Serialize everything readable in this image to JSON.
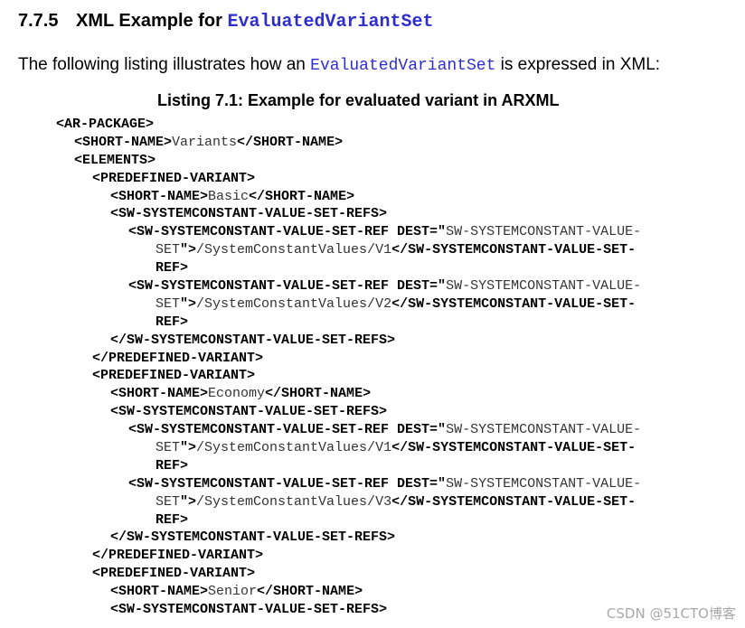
{
  "section": {
    "number": "7.7.5",
    "title_prefix": "XML Example for ",
    "title_code": "EvaluatedVariantSet"
  },
  "intro": {
    "before": "The following listing illustrates how an ",
    "code": "EvaluatedVariantSet",
    "after": " is expressed in XML:"
  },
  "listing": {
    "caption": "Listing 7.1: Example for evaluated variant in ARXML",
    "lines": [
      {
        "indent": 0,
        "segments": [
          {
            "t": "<AR-PACKAGE>"
          }
        ]
      },
      {
        "indent": 2,
        "segments": [
          {
            "t": "<SHORT-NAME>"
          },
          {
            "v": "Variants"
          },
          {
            "t": "</SHORT-NAME>"
          }
        ]
      },
      {
        "indent": 2,
        "segments": [
          {
            "t": "<ELEMENTS>"
          }
        ]
      },
      {
        "indent": 4,
        "segments": [
          {
            "t": "<PREDEFINED-VARIANT>"
          }
        ]
      },
      {
        "indent": 6,
        "segments": [
          {
            "t": "<SHORT-NAME>"
          },
          {
            "v": "Basic"
          },
          {
            "t": "</SHORT-NAME>"
          }
        ]
      },
      {
        "indent": 6,
        "segments": [
          {
            "t": "<SW-SYSTEMCONSTANT-VALUE-SET-REFS>"
          }
        ]
      },
      {
        "indent": 8,
        "segments": [
          {
            "t": "<SW-SYSTEMCONSTANT-VALUE-SET-REF DEST=\""
          },
          {
            "v": "SW-SYSTEMCONSTANT-VALUE-"
          }
        ]
      },
      {
        "indent": 11,
        "segments": [
          {
            "v": "SET"
          },
          {
            "t": "\">"
          },
          {
            "v": "/SystemConstantValues/V1"
          },
          {
            "t": "</SW-SYSTEMCONSTANT-VALUE-SET-"
          }
        ]
      },
      {
        "indent": 11,
        "segments": [
          {
            "t": "REF>"
          }
        ]
      },
      {
        "indent": 8,
        "segments": [
          {
            "t": "<SW-SYSTEMCONSTANT-VALUE-SET-REF DEST=\""
          },
          {
            "v": "SW-SYSTEMCONSTANT-VALUE-"
          }
        ]
      },
      {
        "indent": 11,
        "segments": [
          {
            "v": "SET"
          },
          {
            "t": "\">"
          },
          {
            "v": "/SystemConstantValues/V2"
          },
          {
            "t": "</SW-SYSTEMCONSTANT-VALUE-SET-"
          }
        ]
      },
      {
        "indent": 11,
        "segments": [
          {
            "t": "REF>"
          }
        ]
      },
      {
        "indent": 6,
        "segments": [
          {
            "t": "</SW-SYSTEMCONSTANT-VALUE-SET-REFS>"
          }
        ]
      },
      {
        "indent": 4,
        "segments": [
          {
            "t": "</PREDEFINED-VARIANT>"
          }
        ]
      },
      {
        "indent": 4,
        "segments": [
          {
            "t": "<PREDEFINED-VARIANT>"
          }
        ]
      },
      {
        "indent": 6,
        "segments": [
          {
            "t": "<SHORT-NAME>"
          },
          {
            "v": "Economy"
          },
          {
            "t": "</SHORT-NAME>"
          }
        ]
      },
      {
        "indent": 6,
        "segments": [
          {
            "t": "<SW-SYSTEMCONSTANT-VALUE-SET-REFS>"
          }
        ]
      },
      {
        "indent": 8,
        "segments": [
          {
            "t": "<SW-SYSTEMCONSTANT-VALUE-SET-REF DEST=\""
          },
          {
            "v": "SW-SYSTEMCONSTANT-VALUE-"
          }
        ]
      },
      {
        "indent": 11,
        "segments": [
          {
            "v": "SET"
          },
          {
            "t": "\">"
          },
          {
            "v": "/SystemConstantValues/V1"
          },
          {
            "t": "</SW-SYSTEMCONSTANT-VALUE-SET-"
          }
        ]
      },
      {
        "indent": 11,
        "segments": [
          {
            "t": "REF>"
          }
        ]
      },
      {
        "indent": 8,
        "segments": [
          {
            "t": "<SW-SYSTEMCONSTANT-VALUE-SET-REF DEST=\""
          },
          {
            "v": "SW-SYSTEMCONSTANT-VALUE-"
          }
        ]
      },
      {
        "indent": 11,
        "segments": [
          {
            "v": "SET"
          },
          {
            "t": "\">"
          },
          {
            "v": "/SystemConstantValues/V3"
          },
          {
            "t": "</SW-SYSTEMCONSTANT-VALUE-SET-"
          }
        ]
      },
      {
        "indent": 11,
        "segments": [
          {
            "t": "REF>"
          }
        ]
      },
      {
        "indent": 6,
        "segments": [
          {
            "t": "</SW-SYSTEMCONSTANT-VALUE-SET-REFS>"
          }
        ]
      },
      {
        "indent": 4,
        "segments": [
          {
            "t": "</PREDEFINED-VARIANT>"
          }
        ]
      },
      {
        "indent": 4,
        "segments": [
          {
            "t": "<PREDEFINED-VARIANT>"
          }
        ]
      },
      {
        "indent": 6,
        "segments": [
          {
            "t": "<SHORT-NAME>"
          },
          {
            "v": "Senior"
          },
          {
            "t": "</SHORT-NAME>"
          }
        ]
      },
      {
        "indent": 6,
        "segments": [
          {
            "t": "<SW-SYSTEMCONSTANT-VALUE-SET-REFS>"
          }
        ]
      }
    ]
  },
  "watermark": "CSDN @51CTO博客",
  "colors": {
    "code_link": "#2e2ecf",
    "watermark": "#9a9a9a"
  }
}
